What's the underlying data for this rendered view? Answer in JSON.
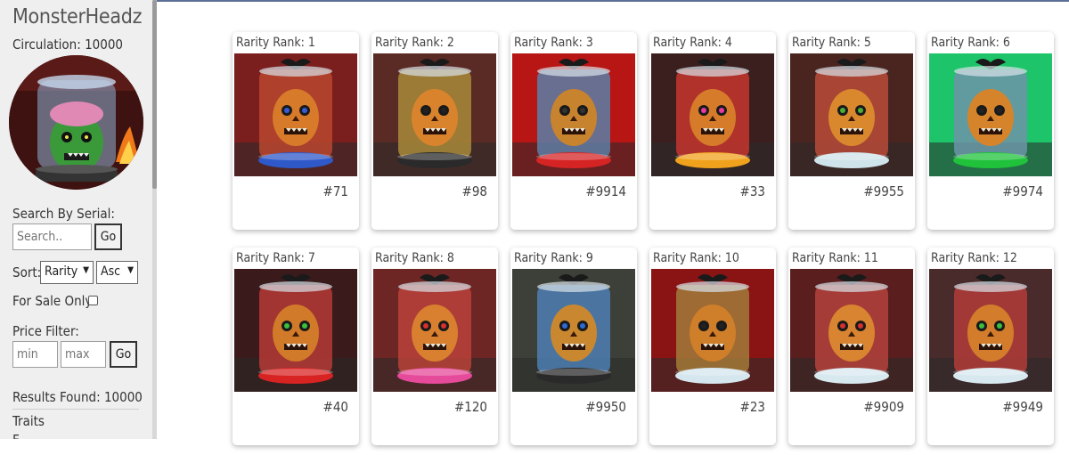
{
  "sidebar": {
    "brand": "MonsterHeadz",
    "circulation": "Circulation: 10000",
    "search_label": "Search By Serial:",
    "search_placeholder": "Search..",
    "search_go": "Go",
    "sort_label": "Sort:",
    "sort_field": "Rarity",
    "sort_order": "Asc",
    "for_sale_label": "For Sale Only:",
    "price_label": "Price Filter:",
    "price_min_placeholder": "min",
    "price_max_placeholder": "max",
    "price_go": "Go",
    "results": "Results Found: 10000",
    "traits": "Traits"
  },
  "cards": [
    {
      "rank": "Rarity Rank: 1",
      "serial": "#71",
      "bg": "#7a1f1e",
      "jar": "#b8462f",
      "head": "#d77a2a",
      "base": "#2f58c9",
      "eyes": "#3a5bd4"
    },
    {
      "rank": "Rarity Rank: 2",
      "serial": "#98",
      "bg": "#5a2a24",
      "jar": "#a88a3a",
      "head": "#d9842c",
      "base": "#2a2a2a",
      "eyes": "#222222"
    },
    {
      "rank": "Rarity Rank: 3",
      "serial": "#9914",
      "bg": "#b81515",
      "jar": "#5b7fa6",
      "head": "#c8832f",
      "base": "#d62424",
      "eyes": "#333333"
    },
    {
      "rank": "Rarity Rank: 4",
      "serial": "#33",
      "bg": "#3b1f1f",
      "jar": "#c7352e",
      "head": "#d57b2a",
      "base": "#f0a21c",
      "eyes": "#e83aa0"
    },
    {
      "rank": "Rarity Rank: 5",
      "serial": "#9955",
      "bg": "#4a2520",
      "jar": "#b94b3a",
      "head": "#d9882e",
      "base": "#cfe3ea",
      "eyes": "#4caf3a"
    },
    {
      "rank": "Rarity Rank: 6",
      "serial": "#9974",
      "bg": "#1ec46a",
      "jar": "#6d94a8",
      "head": "#d5842c",
      "base": "#1fc23a",
      "eyes": "#222222"
    },
    {
      "rank": "Rarity Rank: 7",
      "serial": "#40",
      "bg": "#3a1a1a",
      "jar": "#b53a36",
      "head": "#d17a2a",
      "base": "#d82323",
      "eyes": "#3cbf3c"
    },
    {
      "rank": "Rarity Rank: 8",
      "serial": "#120",
      "bg": "#6e2624",
      "jar": "#b8423a",
      "head": "#d88030",
      "base": "#e64a9a",
      "eyes": "#d63030"
    },
    {
      "rank": "Rarity Rank: 9",
      "serial": "#9950",
      "bg": "#3c4038",
      "jar": "#4d7fb3",
      "head": "#c98830",
      "base": "#2a2a2a",
      "eyes": "#2d6ad6"
    },
    {
      "rank": "Rarity Rank: 10",
      "serial": "#23",
      "bg": "#8a1414",
      "jar": "#a07a38",
      "head": "#cf7e2a",
      "base": "#d5e6ee",
      "eyes": "#222222"
    },
    {
      "rank": "Rarity Rank: 11",
      "serial": "#9909",
      "bg": "#5a1e1e",
      "jar": "#b4423c",
      "head": "#d88430",
      "base": "#d8e8ef",
      "eyes": "#d43030"
    },
    {
      "rank": "Rarity Rank: 12",
      "serial": "#9949",
      "bg": "#4a2b2b",
      "jar": "#b23c38",
      "head": "#d27c2c",
      "base": "#d8e8ef",
      "eyes": "#3cbf3c"
    }
  ]
}
